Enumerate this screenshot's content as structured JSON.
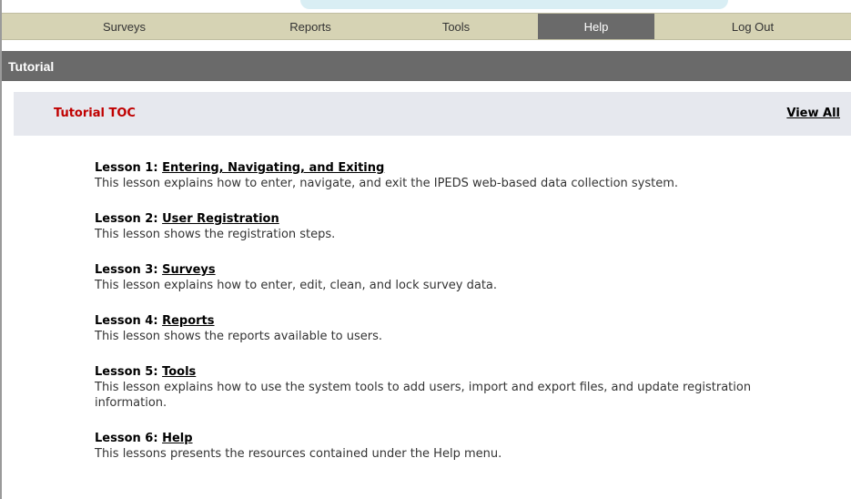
{
  "nav": {
    "items": [
      {
        "label": "Surveys"
      },
      {
        "label": "Reports"
      },
      {
        "label": "Tools"
      },
      {
        "label": "Help"
      },
      {
        "label": "Log Out"
      }
    ]
  },
  "page": {
    "title": "Tutorial"
  },
  "toc": {
    "title": "Tutorial TOC",
    "view_all": "View All"
  },
  "lessons": [
    {
      "prefix": "Lesson 1",
      "link": "Entering, Navigating, and Exiting",
      "description": "This lesson explains how to enter, navigate, and exit the IPEDS web-based data collection system."
    },
    {
      "prefix": "Lesson 2",
      "link": "User Registration",
      "description": "This lesson shows the registration steps."
    },
    {
      "prefix": "Lesson 3",
      "link": "Surveys",
      "description": "This lesson explains how to enter, edit, clean, and lock survey data."
    },
    {
      "prefix": "Lesson 4",
      "link": "Reports",
      "description": "This lesson shows the reports available to users."
    },
    {
      "prefix": "Lesson 5",
      "link": "Tools",
      "description": "This lesson explains how to use the system tools to add users, import and export files, and update registration information."
    },
    {
      "prefix": "Lesson 6",
      "link": "Help",
      "description": "This lessons presents the resources contained under the Help menu."
    }
  ],
  "colors": {
    "nav_bg": "#d6d3b4",
    "active_tab": "#6a6a6a",
    "toc_title": "#c00000",
    "toc_bg": "#e6e8ee"
  }
}
